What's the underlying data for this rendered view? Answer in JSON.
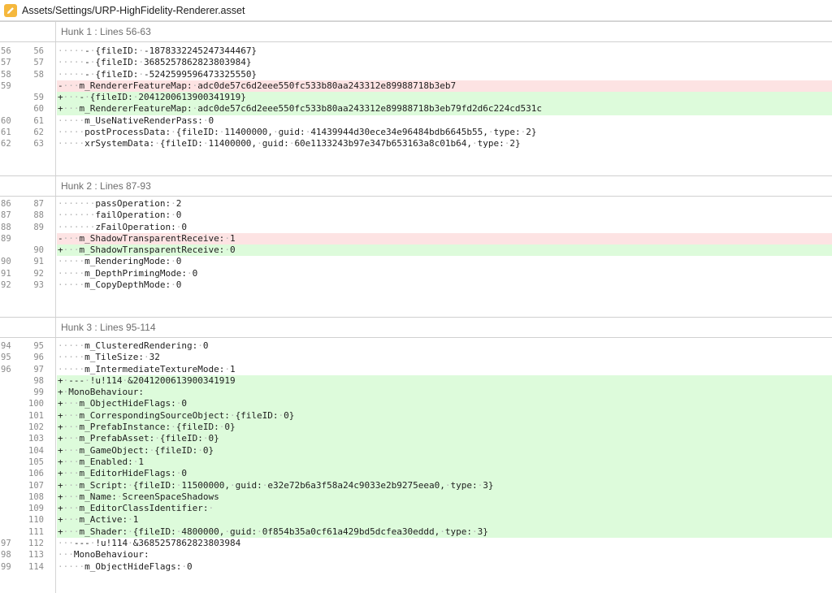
{
  "file": {
    "title": "Assets/Settings/URP-HighFidelity-Renderer.asset",
    "icon": "pencil-edit-icon",
    "icon_color": "#f5b83d"
  },
  "colors": {
    "removed_bg": "#fde3e3",
    "added_bg": "#ddfbdb"
  },
  "hunks": [
    {
      "header": "Hunk 1 : Lines 56-63",
      "lines": [
        {
          "type": "ctx",
          "old": "56",
          "new": "56",
          "text": "·····-·{fileID:·-1878332245247344467}"
        },
        {
          "type": "ctx",
          "old": "57",
          "new": "57",
          "text": "·····-·{fileID:·3685257862823803984}"
        },
        {
          "type": "ctx",
          "old": "58",
          "new": "58",
          "text": "·····-·{fileID:·-5242599596473325550}"
        },
        {
          "type": "del",
          "old": "59",
          "new": "",
          "text": "-···m_RendererFeatureMap:·adc0de57c6d2eee550fc533b80aa243312e89988718b3eb7"
        },
        {
          "type": "add",
          "old": "",
          "new": "59",
          "text": "+···-·{fileID:·2041200613900341919}"
        },
        {
          "type": "add",
          "old": "",
          "new": "60",
          "text": "+···m_RendererFeatureMap:·adc0de57c6d2eee550fc533b80aa243312e89988718b3eb79fd2d6c224cd531c"
        },
        {
          "type": "ctx",
          "old": "60",
          "new": "61",
          "text": "·····m_UseNativeRenderPass:·0"
        },
        {
          "type": "ctx",
          "old": "61",
          "new": "62",
          "text": "·····postProcessData:·{fileID:·11400000,·guid:·41439944d30ece34e96484bdb6645b55,·type:·2}"
        },
        {
          "type": "ctx",
          "old": "62",
          "new": "63",
          "text": "·····xrSystemData:·{fileID:·11400000,·guid:·60e1133243b97e347b653163a8c01b64,·type:·2}"
        }
      ]
    },
    {
      "header": "Hunk 2 : Lines 87-93",
      "lines": [
        {
          "type": "ctx",
          "old": "86",
          "new": "87",
          "text": "·······passOperation:·2"
        },
        {
          "type": "ctx",
          "old": "87",
          "new": "88",
          "text": "·······failOperation:·0"
        },
        {
          "type": "ctx",
          "old": "88",
          "new": "89",
          "text": "·······zFailOperation:·0"
        },
        {
          "type": "del",
          "old": "89",
          "new": "",
          "text": "-···m_ShadowTransparentReceive:·1"
        },
        {
          "type": "add",
          "old": "",
          "new": "90",
          "text": "+···m_ShadowTransparentReceive:·0"
        },
        {
          "type": "ctx",
          "old": "90",
          "new": "91",
          "text": "·····m_RenderingMode:·0"
        },
        {
          "type": "ctx",
          "old": "91",
          "new": "92",
          "text": "·····m_DepthPrimingMode:·0"
        },
        {
          "type": "ctx",
          "old": "92",
          "new": "93",
          "text": "·····m_CopyDepthMode:·0"
        }
      ]
    },
    {
      "header": "Hunk 3 : Lines 95-114",
      "lines": [
        {
          "type": "ctx",
          "old": "94",
          "new": "95",
          "text": "·····m_ClusteredRendering:·0"
        },
        {
          "type": "ctx",
          "old": "95",
          "new": "96",
          "text": "·····m_TileSize:·32"
        },
        {
          "type": "ctx",
          "old": "96",
          "new": "97",
          "text": "·····m_IntermediateTextureMode:·1"
        },
        {
          "type": "add",
          "old": "",
          "new": "98",
          "text": "+·---·!u!114·&2041200613900341919"
        },
        {
          "type": "add",
          "old": "",
          "new": "99",
          "text": "+·MonoBehaviour:"
        },
        {
          "type": "add",
          "old": "",
          "new": "100",
          "text": "+···m_ObjectHideFlags:·0"
        },
        {
          "type": "add",
          "old": "",
          "new": "101",
          "text": "+···m_CorrespondingSourceObject:·{fileID:·0}"
        },
        {
          "type": "add",
          "old": "",
          "new": "102",
          "text": "+···m_PrefabInstance:·{fileID:·0}"
        },
        {
          "type": "add",
          "old": "",
          "new": "103",
          "text": "+···m_PrefabAsset:·{fileID:·0}"
        },
        {
          "type": "add",
          "old": "",
          "new": "104",
          "text": "+···m_GameObject:·{fileID:·0}"
        },
        {
          "type": "add",
          "old": "",
          "new": "105",
          "text": "+···m_Enabled:·1"
        },
        {
          "type": "add",
          "old": "",
          "new": "106",
          "text": "+···m_EditorHideFlags:·0"
        },
        {
          "type": "add",
          "old": "",
          "new": "107",
          "text": "+···m_Script:·{fileID:·11500000,·guid:·e32e72b6a3f58a24c9033e2b9275eea0,·type:·3}"
        },
        {
          "type": "add",
          "old": "",
          "new": "108",
          "text": "+···m_Name:·ScreenSpaceShadows"
        },
        {
          "type": "add",
          "old": "",
          "new": "109",
          "text": "+···m_EditorClassIdentifier:·"
        },
        {
          "type": "add",
          "old": "",
          "new": "110",
          "text": "+···m_Active:·1"
        },
        {
          "type": "add",
          "old": "",
          "new": "111",
          "text": "+···m_Shader:·{fileID:·4800000,·guid:·0f854b35a0cf61a429bd5dcfea30eddd,·type:·3}"
        },
        {
          "type": "ctx",
          "old": "97",
          "new": "112",
          "text": "···---·!u!114·&3685257862823803984"
        },
        {
          "type": "ctx",
          "old": "98",
          "new": "113",
          "text": "···MonoBehaviour:"
        },
        {
          "type": "ctx",
          "old": "99",
          "new": "114",
          "text": "·····m_ObjectHideFlags:·0"
        }
      ]
    }
  ]
}
